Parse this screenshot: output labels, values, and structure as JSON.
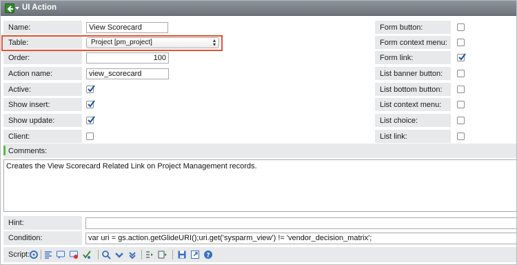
{
  "window": {
    "title": "UI Action"
  },
  "form": {
    "name": {
      "label": "Name:",
      "value": "View Scorecard"
    },
    "table": {
      "label": "Table:",
      "value": "Project [pm_project]"
    },
    "order": {
      "label": "Order:",
      "value": "100"
    },
    "action_name": {
      "label": "Action name:",
      "value": "view_scorecard"
    },
    "active": {
      "label": "Active:",
      "checked": true
    },
    "show_insert": {
      "label": "Show insert:",
      "checked": true
    },
    "show_update": {
      "label": "Show update:",
      "checked": true
    },
    "client": {
      "label": "Client:",
      "checked": false
    }
  },
  "right_options": [
    {
      "label": "Form button:",
      "checked": false
    },
    {
      "label": "Form context menu:",
      "checked": false
    },
    {
      "label": "Form link:",
      "checked": true
    },
    {
      "label": "List banner button:",
      "checked": false
    },
    {
      "label": "List bottom button:",
      "checked": false
    },
    {
      "label": "List context menu:",
      "checked": false
    },
    {
      "label": "List choice:",
      "checked": false
    },
    {
      "label": "List link:",
      "checked": false
    }
  ],
  "comments": {
    "label": "Comments:",
    "value": "Creates the View Scorecard Related Link on Project Management records."
  },
  "hint": {
    "label": "Hint:",
    "value": ""
  },
  "condition": {
    "label": "Condition:",
    "value": "var uri = gs.action.getGlideURI();uri.get('sysparm_view') != 'vendor_decision_matrix';"
  },
  "script": {
    "label": "Script:",
    "tools": [
      "toggle-syntax-icon",
      "format-icon",
      "comment-icon",
      "uncomment-icon",
      "check-syntax-icon",
      "search-icon",
      "replace-icon",
      "replace-all-icon",
      "save-icon",
      "fullscreen-icon",
      "help-icon"
    ]
  },
  "colors": {
    "highlight": "#e2522f",
    "accent_green": "#58b947",
    "check_blue": "#1d4fa8"
  }
}
